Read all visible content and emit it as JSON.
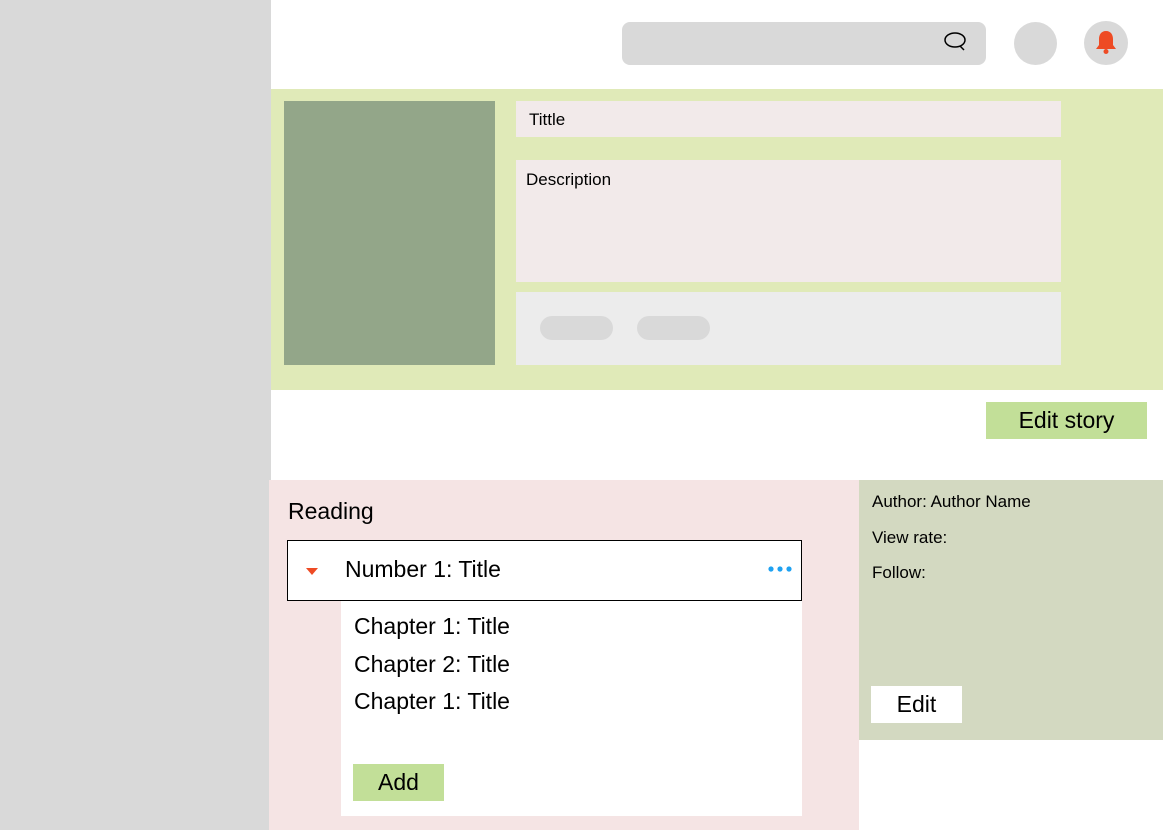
{
  "header": {
    "search_icon": "search-icon",
    "avatar_icon": "avatar",
    "notification_icon": "bell-icon"
  },
  "story": {
    "title_placeholder": "Tittle",
    "description_placeholder": "Description",
    "edit_label": "Edit story"
  },
  "reading": {
    "heading": "Reading",
    "volume": {
      "title": "Number 1: Title",
      "expand_icon": "caret-down-icon",
      "menu_icon": "more-horizontal-icon"
    },
    "chapters": [
      {
        "label": "Chapter 1: Title"
      },
      {
        "label": "Chapter 2: Title"
      },
      {
        "label": "Chapter 1: Title"
      }
    ],
    "add_label": "Add"
  },
  "info": {
    "author": "Author: Author Name",
    "view_rate": "View rate:",
    "follow": "Follow:",
    "edit_label": "Edit"
  },
  "colors": {
    "sidebar": "#d9d9d9",
    "banner": "#e0eab8",
    "cover": "#93a689",
    "field": "#f2eaea",
    "button_green": "#c2df98",
    "reading_panel": "#f5e4e4",
    "info_panel": "#d3d9c1",
    "accent_red": "#ee4b24",
    "accent_blue": "#1ea1f1"
  }
}
